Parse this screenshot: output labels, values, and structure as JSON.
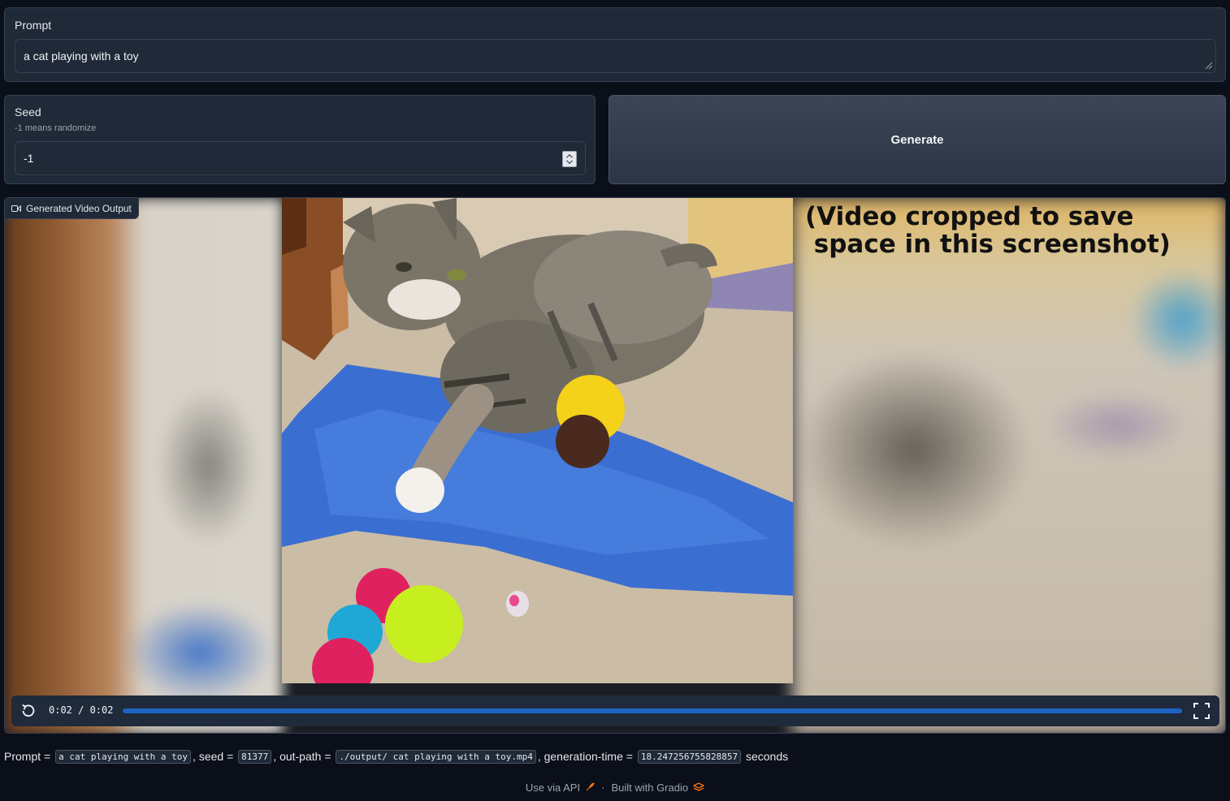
{
  "prompt": {
    "label": "Prompt",
    "value": "a cat playing with a toy"
  },
  "seed": {
    "label": "Seed",
    "info": "-1 means randomize",
    "value": "-1"
  },
  "generate_button": {
    "label": "Generate"
  },
  "video": {
    "label": "Generated Video Output",
    "overlay_note": "(Video cropped to save\n space in this screenshot)",
    "time_display": "0:02 / 0:02",
    "progress": 1.0
  },
  "result": {
    "prompt_key": "Prompt",
    "prompt_value": "a cat playing with a toy",
    "seed_key": "seed",
    "seed_value": "81377",
    "outpath_key": "out-path",
    "outpath_value": "./output/ cat playing with a toy.mp4",
    "gentime_key": "generation-time",
    "gentime_value": "18.247256755828857",
    "unit": "seconds"
  },
  "footer": {
    "api_link": "Use via API",
    "separator": "·",
    "built_with": "Built with Gradio"
  },
  "colors": {
    "background": "#0b0f19",
    "panel": "#1f2937",
    "progress": "#1d63c4",
    "gradio_logo": "#f97316"
  }
}
